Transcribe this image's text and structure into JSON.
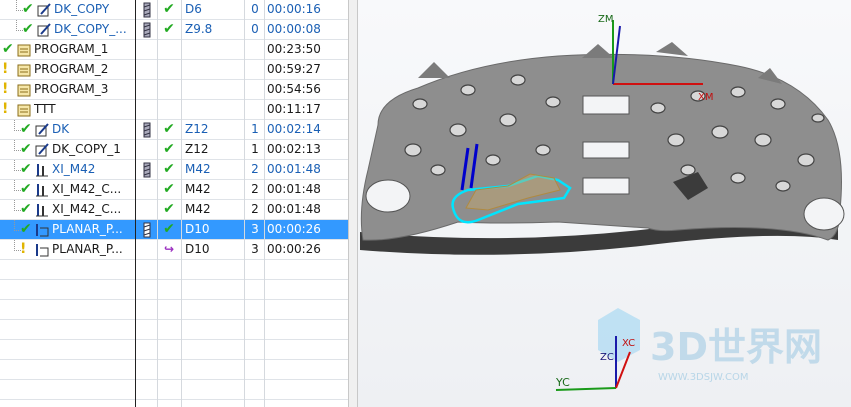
{
  "navigator": {
    "rows": [
      {
        "name": "DK_COPY",
        "status": "check",
        "icon": "mill-contour-icon",
        "level": 2,
        "tool_icon": "tool-holder-icon",
        "path": "check",
        "tool": "D6",
        "num": "0",
        "time": "00:00:16",
        "link": true
      },
      {
        "name": "DK_COPY_...",
        "status": "check",
        "icon": "mill-contour-icon",
        "level": 2,
        "tool_icon": "tool-holder-icon",
        "path": "check",
        "tool": "Z9.8",
        "num": "0",
        "time": "00:00:08",
        "link": true
      },
      {
        "name": "PROGRAM_1",
        "status": "check",
        "icon": "program-group-icon",
        "level": 0,
        "tool_icon": "",
        "path": "",
        "tool": "",
        "num": "",
        "time": "00:23:50",
        "link": false
      },
      {
        "name": "PROGRAM_2",
        "status": "bang",
        "icon": "program-group-icon",
        "level": 0,
        "tool_icon": "",
        "path": "",
        "tool": "",
        "num": "",
        "time": "00:59:27",
        "link": false
      },
      {
        "name": "PROGRAM_3",
        "status": "bang",
        "icon": "program-group-icon",
        "level": 0,
        "tool_icon": "",
        "path": "",
        "tool": "",
        "num": "",
        "time": "00:54:56",
        "link": false
      },
      {
        "name": "TTT",
        "status": "bang",
        "icon": "program-group-icon",
        "level": 0,
        "tool_icon": "",
        "path": "",
        "tool": "",
        "num": "",
        "time": "00:11:17",
        "link": false
      },
      {
        "name": "DK",
        "status": "check",
        "icon": "mill-contour-icon",
        "level": 1,
        "tool_icon": "tool-holder-icon",
        "path": "check",
        "tool": "Z12",
        "num": "1",
        "time": "00:02:14",
        "link": true
      },
      {
        "name": "DK_COPY_1",
        "status": "check",
        "icon": "mill-contour-icon",
        "level": 1,
        "tool_icon": "",
        "path": "check",
        "tool": "Z12",
        "num": "1",
        "time": "00:02:13",
        "link": false
      },
      {
        "name": "XI_M42",
        "status": "check",
        "icon": "hole-drill-icon",
        "level": 1,
        "tool_icon": "tool-holder-icon",
        "path": "check",
        "tool": "M42",
        "num": "2",
        "time": "00:01:48",
        "link": true
      },
      {
        "name": "XI_M42_C...",
        "status": "check",
        "icon": "hole-drill-icon",
        "level": 1,
        "tool_icon": "",
        "path": "check",
        "tool": "M42",
        "num": "2",
        "time": "00:01:48",
        "link": false
      },
      {
        "name": "XI_M42_C...",
        "status": "check",
        "icon": "hole-drill-icon",
        "level": 1,
        "tool_icon": "",
        "path": "check",
        "tool": "M42",
        "num": "2",
        "time": "00:01:48",
        "link": false
      },
      {
        "name": "PLANAR_P...",
        "status": "check",
        "icon": "planar-mill-icon",
        "level": 1,
        "tool_icon": "tool-holder-icon",
        "path": "check",
        "tool": "D10",
        "num": "3",
        "time": "00:00:26",
        "link": false,
        "selected": true
      },
      {
        "name": "PLANAR_P...",
        "status": "bang",
        "icon": "planar-mill-icon",
        "level": 1,
        "tool_icon": "",
        "path": "regen",
        "tool": "D10",
        "num": "3",
        "time": "00:00:26",
        "link": false
      }
    ],
    "empty_rows": 7
  },
  "viewport": {
    "axis_labels": {
      "zm": "ZM",
      "xm": "XM",
      "zc": "ZC",
      "xc": "XC",
      "yc": "YC"
    },
    "watermark": {
      "title": "3D世界网",
      "url": "WWW.3DSJW.COM"
    }
  }
}
